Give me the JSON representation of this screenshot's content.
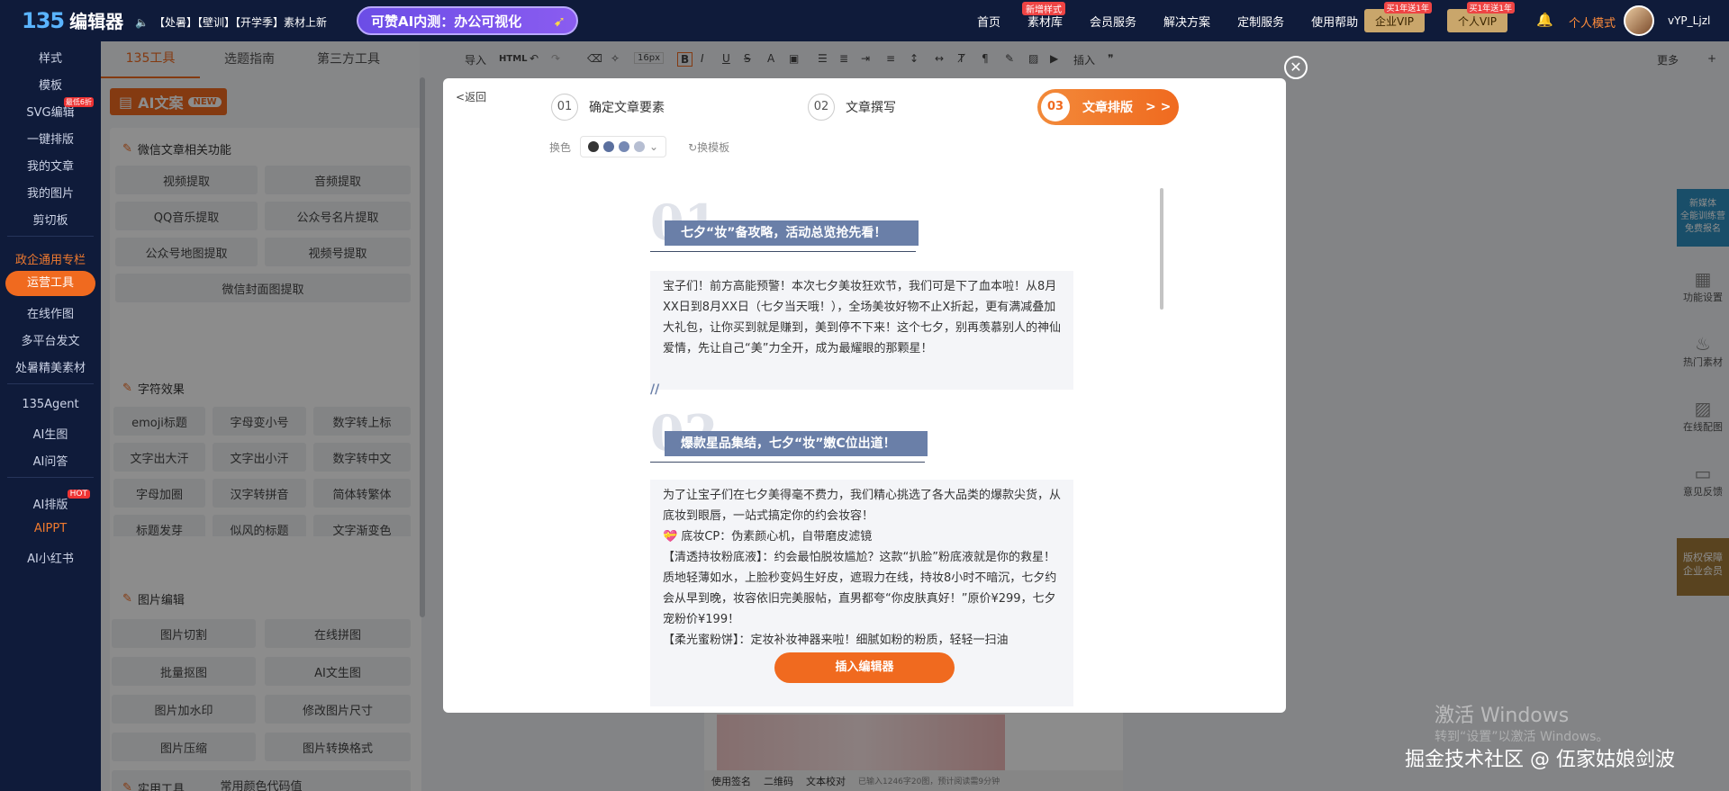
{
  "topbar": {
    "logo_mark": "135",
    "logo_text": "编辑器",
    "notice": "【处暑】【壁训】【开学季】素材上新",
    "ai_banner": "可赞AI内测：办公可视化",
    "nav": [
      {
        "label": "首页",
        "badge": ""
      },
      {
        "label": "素材库",
        "badge": "新增样式"
      },
      {
        "label": "会员服务",
        "badge": ""
      },
      {
        "label": "解决方案",
        "badge": ""
      },
      {
        "label": "定制服务",
        "badge": ""
      },
      {
        "label": "使用帮助",
        "badge": ""
      }
    ],
    "enterprise_vip": "企业VIP",
    "enterprise_vip_tag": "买1年送1年",
    "personal_vip": "个人VIP",
    "personal_vip_tag": "买1年送1年",
    "mode": "个人模式",
    "username": "vYP_Ljzl"
  },
  "leftnav": {
    "items": [
      "样式",
      "模板",
      "SVG编辑",
      "一键排版",
      "我的文章",
      "我的图片",
      "剪切板",
      "政企通用专栏",
      "运营工具",
      "在线作图",
      "多平台发文",
      "处暑精美素材",
      "135Agent",
      "AI生图",
      "AI问答",
      "AI排版",
      "AIPPT",
      "AI小红书"
    ],
    "svg_tag": "最低6折",
    "hot_tag": "HOT"
  },
  "toolpanel": {
    "tabs": [
      "135工具",
      "选题指南",
      "第三方工具"
    ],
    "ai_title": "AI文案",
    "ai_new": "NEW",
    "sections": [
      {
        "title": "微信文章相关功能",
        "buttons": [
          "视频提取",
          "音频提取",
          "QQ音乐提取",
          "公众号名片提取",
          "公众号地图提取",
          "视频号提取",
          "微信封面图提取"
        ]
      },
      {
        "title": "字符效果",
        "buttons": [
          "emoji标题",
          "字母变小号",
          "数字转上标",
          "文字出大汗",
          "文字出小汗",
          "数字转中文",
          "字母加圈",
          "汉字转拼音",
          "简体转繁体",
          "标题发芽",
          "似风的标题",
          "文字渐变色"
        ]
      },
      {
        "title": "图片编辑",
        "buttons": [
          "图片切割",
          "在线拼图",
          "批量抠图",
          "AI文生图",
          "图片加水印",
          "修改图片尺寸",
          "图片压缩",
          "图片转换格式",
          "常用颜色代码值"
        ]
      },
      {
        "title": "实用工具"
      }
    ]
  },
  "editorbar": {
    "import": "导入",
    "html": "HTML",
    "font_size": "16px",
    "insert": "插入",
    "more": "更多"
  },
  "modal": {
    "back": "返回",
    "steps": [
      {
        "num": "01",
        "label": "确定文章要素"
      },
      {
        "num": "02",
        "label": "文章撰写"
      },
      {
        "num": "03",
        "label": "文章排版"
      }
    ],
    "step3_arrows": "> >",
    "color_label": "换色",
    "colors": [
      "#333333",
      "#5a6f9e",
      "#7689b4",
      "#b6bed2"
    ],
    "template_label": "换模板",
    "insert_button": "插入编辑器",
    "article": [
      {
        "num": "01",
        "title": "七夕“妆”备攻略，活动总览抢先看！",
        "paragraphs": [
          "宝子们！前方高能预警！本次七夕美妆狂欢节，我们可是下了血本啦！从8月XX日到8月XX日（七夕当天哦！），全场美妆好物不止X折起，更有满减叠加大礼包，让你买到就是赚到，美到停不下来！这个七夕，别再羡慕别人的神仙爱情，先让自己“美”力全开，成为最耀眼的那颗星！"
        ]
      },
      {
        "num": "02",
        "title": "爆款星品集结，七夕“妆”嫩C位出道！",
        "paragraphs": [
          "为了让宝子们在七夕美得毫不费力，我们精心挑选了各大品类的爆款尖货，从底妆到眼唇，一站式搞定你的约会妆容！",
          "💝 底妆CP：伪素颜心机，自带磨皮滤镜",
          "【清透持妆粉底液】：约会最怕脱妆尴尬？这款“扒脸”粉底液就是你的救星！质地轻薄如水，上脸秒变妈生好皮，遮瑕力在线，持妆8小时不暗沉，七夕约会从早到晚，妆容依旧完美服帖，直男都夸“你皮肤真好！”原价¥299，七夕宠粉价¥199！",
          "【柔光蜜粉饼】：定妆补妆神器来啦！细腻如粉的粉质，轻轻一扫油"
        ]
      }
    ]
  },
  "underlay": {
    "footer": [
      "使用签名",
      "二维码",
      "文本校对"
    ],
    "count": "已输入1246字20图，预计阅读需9分钟"
  },
  "rightbar": {
    "ad_top": [
      "新媒体",
      "全能训练营",
      "免费报名"
    ],
    "items": [
      "功能设置",
      "热门素材",
      "在线配图",
      "意见反馈"
    ],
    "ad_bottom": [
      "版权保障",
      "企业会员"
    ]
  },
  "watermark": {
    "line1": "激活 Windows",
    "line2": "转到“设置”以激活 Windows。",
    "juejin": "掘金技术社区 @ 伍家姑娘剑波"
  }
}
